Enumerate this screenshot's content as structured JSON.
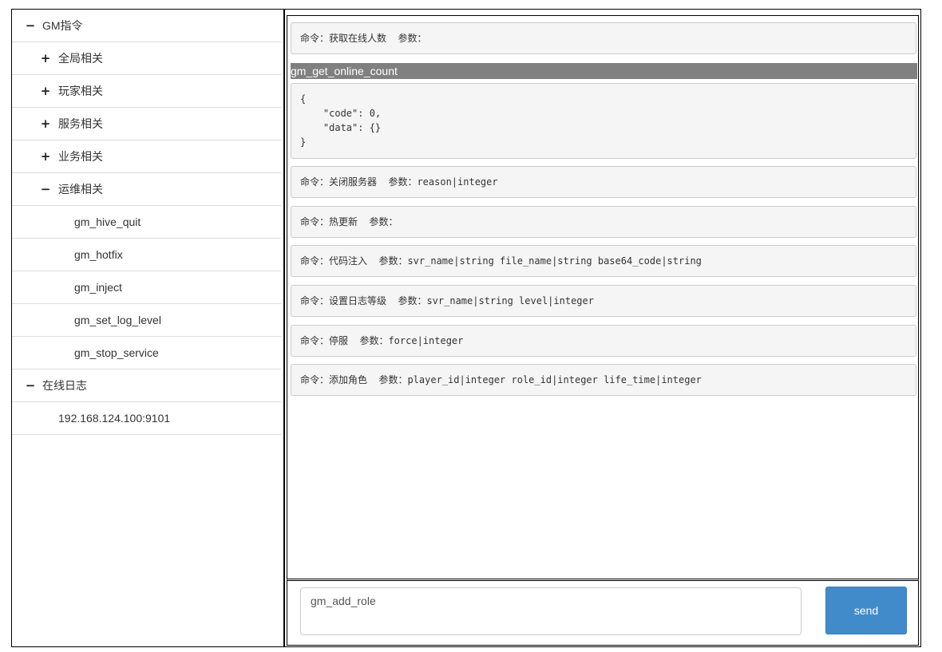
{
  "tree": {
    "items": [
      {
        "toggle": "−",
        "label": "GM指令"
      },
      {
        "toggle": "+",
        "label": "全局相关"
      },
      {
        "toggle": "+",
        "label": "玩家相关"
      },
      {
        "toggle": "+",
        "label": "服务相关"
      },
      {
        "toggle": "+",
        "label": "业务相关"
      },
      {
        "toggle": "−",
        "label": "运维相关"
      },
      {
        "label": "gm_hive_quit"
      },
      {
        "label": "gm_hotfix"
      },
      {
        "label": "gm_inject"
      },
      {
        "label": "gm_set_log_level"
      },
      {
        "label": "gm_stop_service"
      },
      {
        "toggle": "−",
        "label": "在线日志"
      },
      {
        "label": "192.168.124.100:9101"
      }
    ]
  },
  "output": {
    "first_command": "命令：获取在线人数  参数：",
    "result_header": "gm_get_online_count",
    "result_body": "{\n    \"code\": 0,\n    \"data\": {}\n}",
    "commands": [
      "命令：关闭服务器  参数：reason|integer",
      "命令：热更新  参数：",
      "命令：代码注入  参数：svr_name|string file_name|string base64_code|string",
      "命令：设置日志等级  参数：svr_name|string level|integer",
      "命令：停服  参数：force|integer",
      "命令：添加角色  参数：player_id|integer role_id|integer life_time|integer"
    ]
  },
  "input": {
    "value": "gm_add_role",
    "send_label": "send"
  },
  "colors": {
    "send_button": "#428bca",
    "result_header_bg": "#808080",
    "well_bg": "#f5f5f5"
  }
}
